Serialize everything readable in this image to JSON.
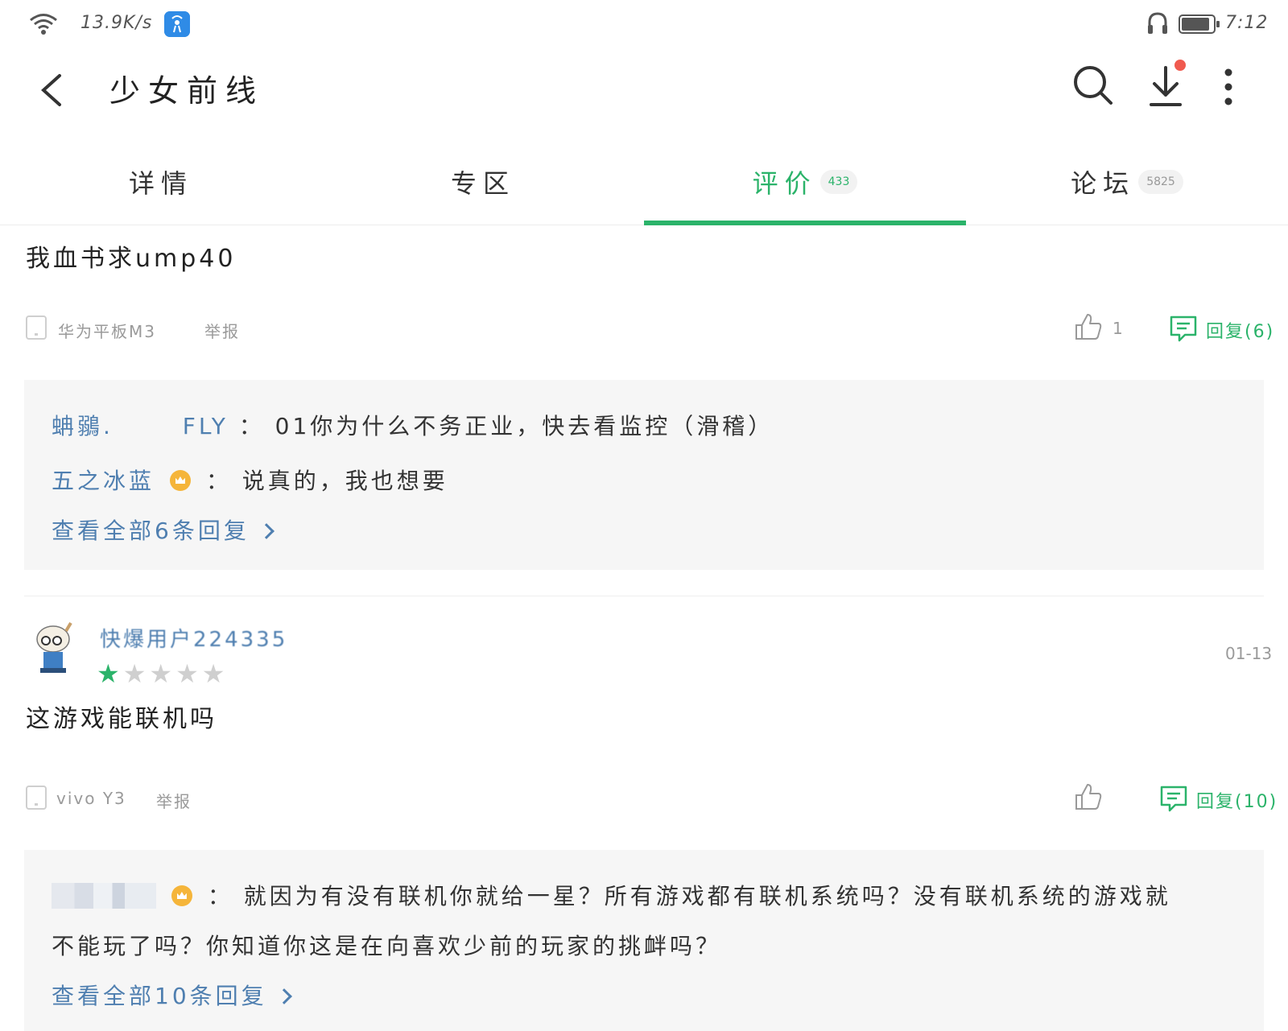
{
  "status_bar": {
    "speed": "13.9K/s",
    "time": "7:12"
  },
  "header": {
    "title": "少女前线"
  },
  "tabs": [
    {
      "label": "详情",
      "count": ""
    },
    {
      "label": "专区",
      "count": ""
    },
    {
      "label": "评价",
      "count": "433",
      "active": true
    },
    {
      "label": "论坛",
      "count": "5825"
    }
  ],
  "reviews": [
    {
      "text": "我血书求ump40",
      "device": "华为平板M3",
      "report": "举报",
      "likes": "1",
      "reply_label": "回复(6)",
      "replies": [
        {
          "user": "蚺鶸.",
          "user2": "FLY",
          "sep": "：",
          "text": "01你为什么不务正业，快去看监控（滑稽）"
        },
        {
          "user": "五之冰蓝",
          "sep": "：",
          "text": "说真的，我也想要"
        }
      ],
      "view_all": "查看全部6条回复"
    },
    {
      "username": "快爆用户224335",
      "rating": 1,
      "max_rating": 5,
      "date": "01-13",
      "text": "这游戏能联机吗",
      "device": "vivo Y3",
      "report": "举报",
      "likes": "",
      "reply_label": "回复(10)",
      "replies": [
        {
          "sep": "：",
          "text_line1": "就因为有没有联机你就给一星？所有游戏都有联机系统吗？没有联机系统的游戏就",
          "text_line2": "不能玩了吗？你知道你这是在向喜欢少前的玩家的挑衅吗？"
        }
      ],
      "view_all": "查看全部10条回复"
    }
  ],
  "colors": {
    "accent": "#2bb36a",
    "link": "#4f7fb0",
    "reply_bg": "#f6f6f6"
  }
}
